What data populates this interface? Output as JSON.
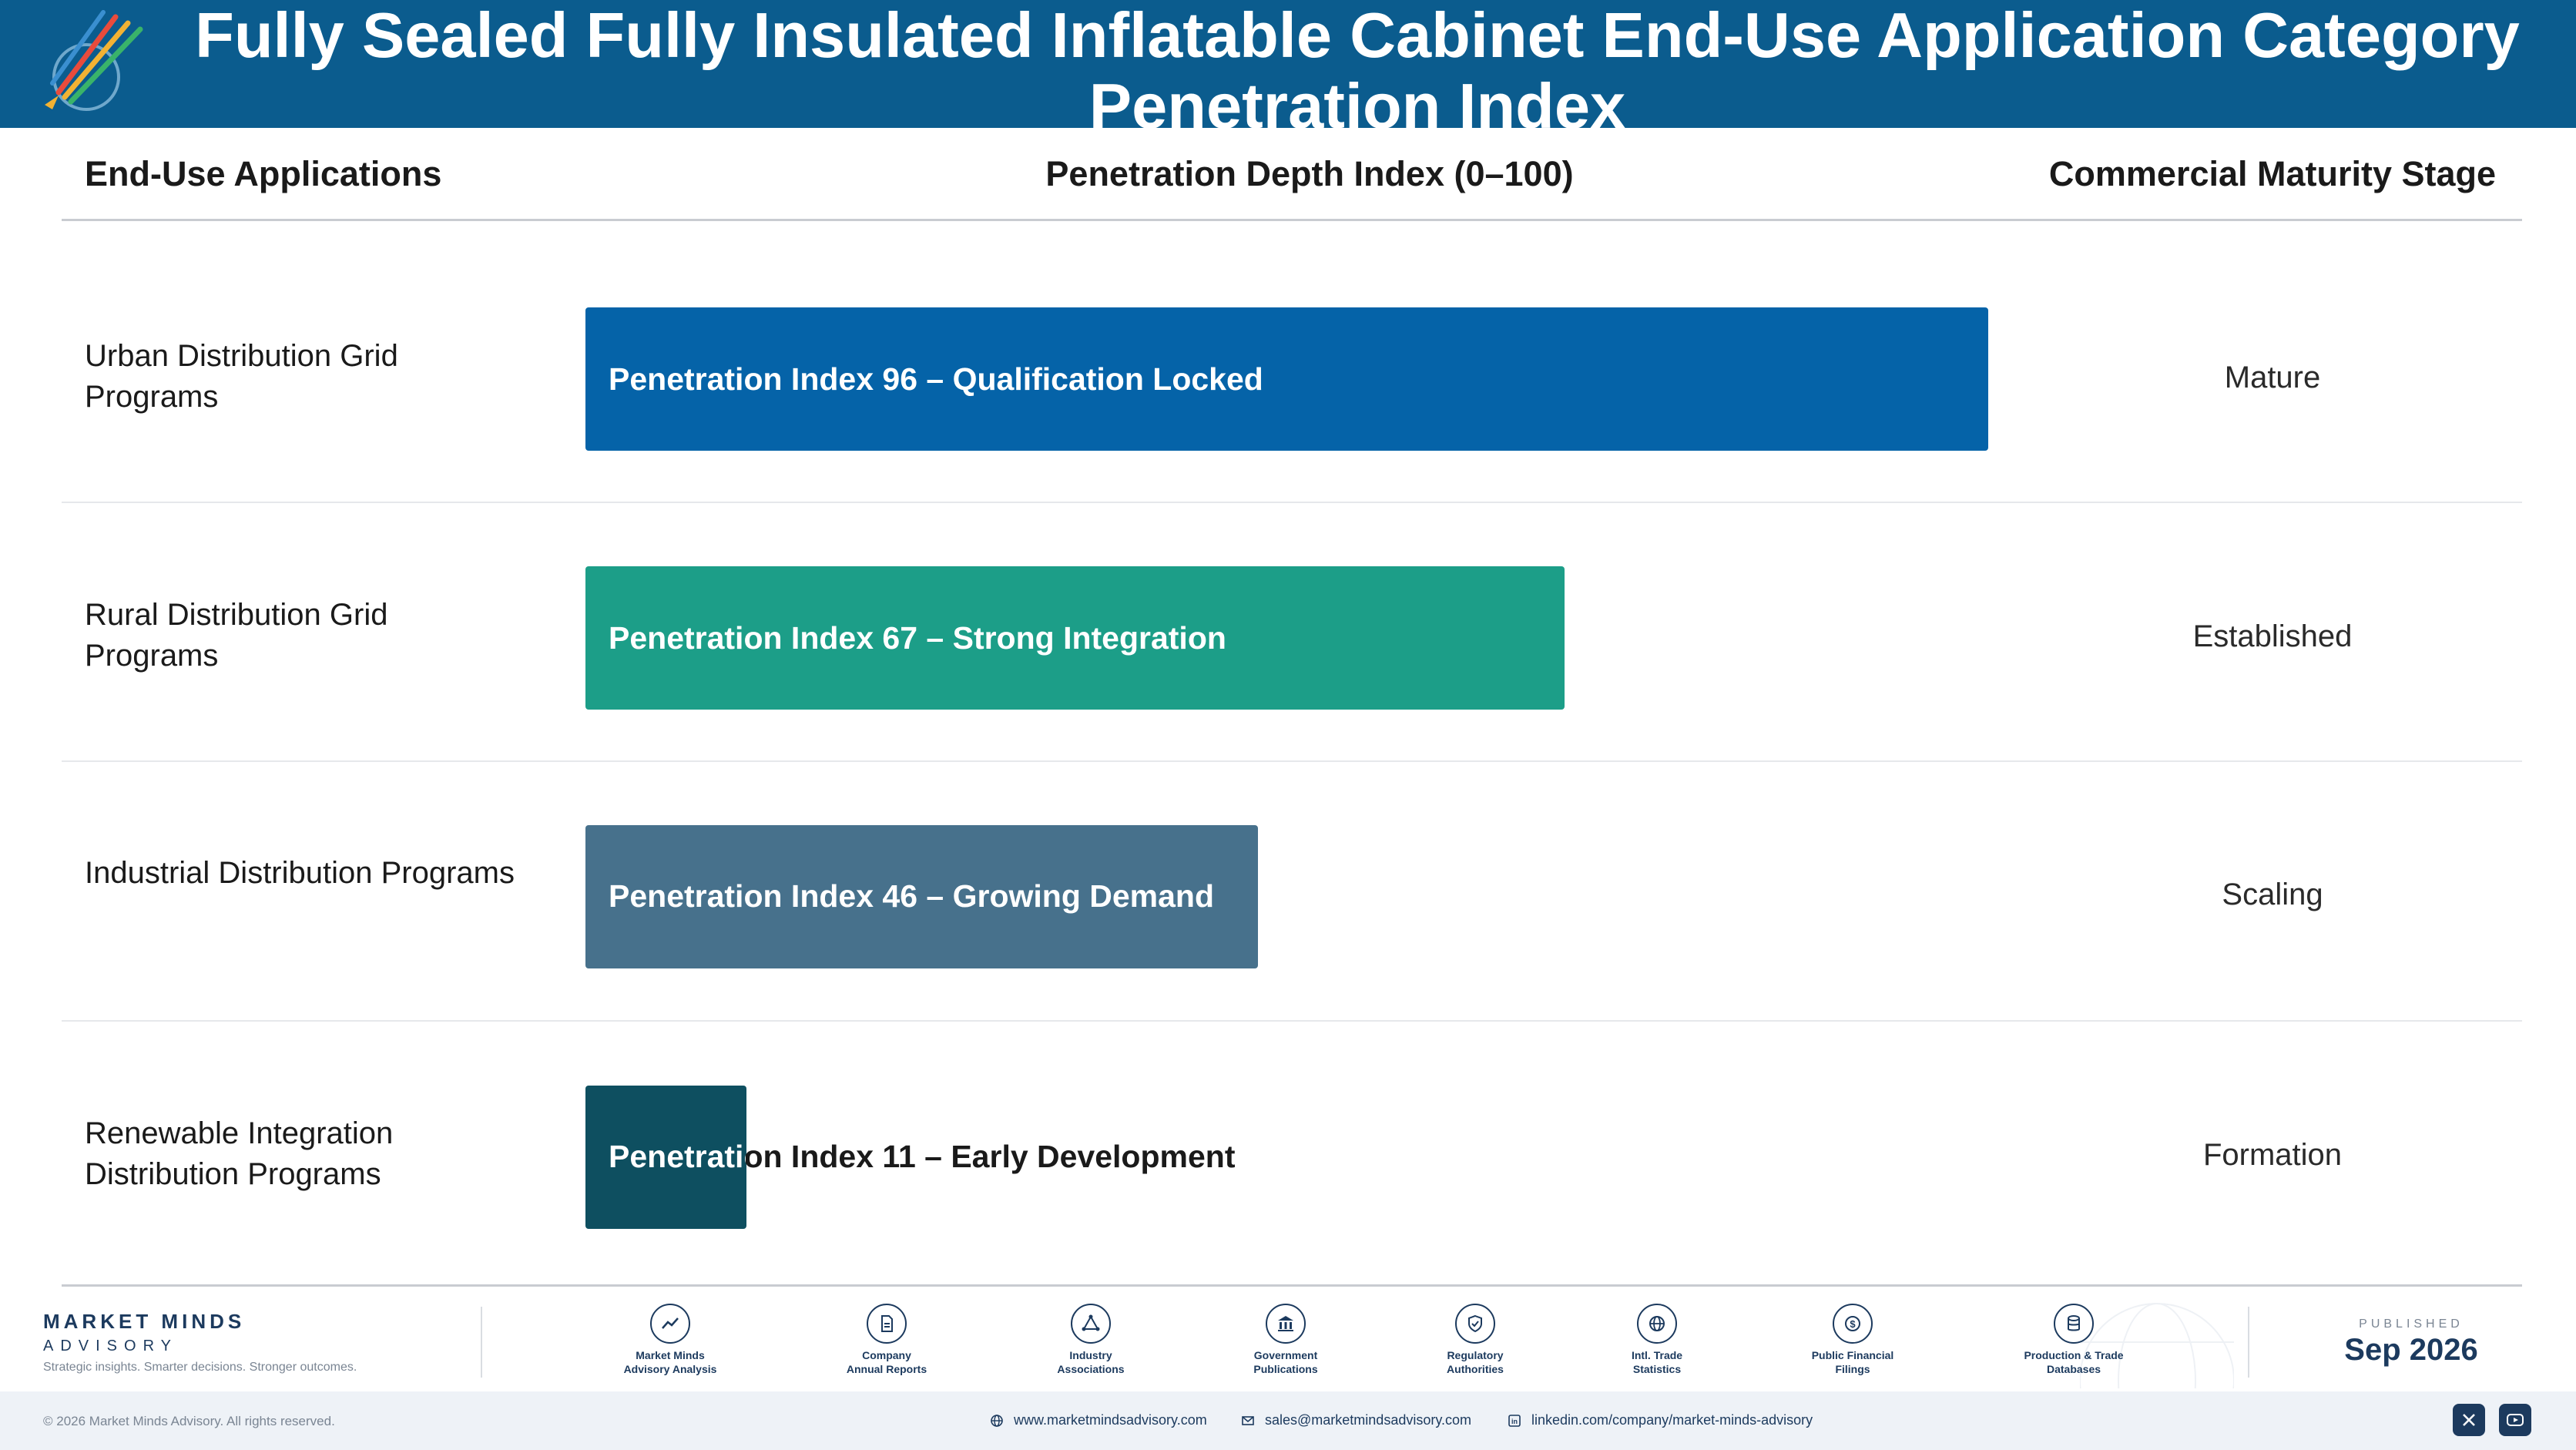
{
  "header": {
    "title": "Fully Sealed Fully Insulated Inflatable Cabinet End-Use Application Category Penetration Index",
    "logo_icon": "rising-arrows-logo-icon"
  },
  "table": {
    "columns": [
      "End-Use Applications",
      "Penetration Depth Index (0–100)",
      "Commercial Maturity Stage"
    ]
  },
  "chart_data": {
    "type": "bar",
    "orientation": "horizontal",
    "title": "Fully Sealed Fully Insulated Inflatable Cabinet End-Use Application Category Penetration Index",
    "xlabel": "Penetration Depth Index (0–100)",
    "ylabel": "End-Use Applications",
    "xlim": [
      0,
      100
    ],
    "grid": false,
    "categories": [
      "Urban Distribution Grid Programs",
      "Rural Distribution Grid Programs",
      "Industrial Distribution Programs",
      "Renewable Integration Distribution Programs"
    ],
    "values": [
      96,
      67,
      46,
      11
    ],
    "bar_labels": [
      "Penetration Index 96 – Qualification Locked",
      "Penetration Index 67 – Strong Integration",
      "Penetration Index 46 – Growing Demand",
      "Penetration Index 11 – Early Development"
    ],
    "stages": [
      "Mature",
      "Established",
      "Scaling",
      "Formation"
    ],
    "colors": [
      "#0563a8",
      "#1c9e88",
      "#47718c",
      "#0e4f60"
    ]
  },
  "footer": {
    "brand_name": "MARKET MINDS",
    "brand_sub": "ADVISORY",
    "brand_tagline": "Strategic insights. Smarter decisions. Stronger outcomes.",
    "sources": [
      {
        "label_1": "Market Minds",
        "label_2": "Advisory Analysis",
        "icon": "chart-trend-icon"
      },
      {
        "label_1": "Company",
        "label_2": "Annual Reports",
        "icon": "document-icon"
      },
      {
        "label_1": "Industry",
        "label_2": "Associations",
        "icon": "network-icon"
      },
      {
        "label_1": "Government",
        "label_2": "Publications",
        "icon": "government-building-icon"
      },
      {
        "label_1": "Regulatory",
        "label_2": "Authorities",
        "icon": "shield-icon"
      },
      {
        "label_1": "Intl. Trade",
        "label_2": "Statistics",
        "icon": "globe-icon"
      },
      {
        "label_1": "Public Financial",
        "label_2": "Filings",
        "icon": "dollar-coin-icon"
      },
      {
        "label_1": "Production & Trade",
        "label_2": "Databases",
        "icon": "database-icon"
      }
    ],
    "published_label": "PUBLISHED",
    "published_date": "Sep 2026",
    "copyright": "© 2026 Market Minds Advisory. All rights reserved.",
    "website": "www.marketmindsadvisory.com",
    "email": "sales@marketmindsadvisory.com",
    "linkedin": "linkedin.com/company/market-minds-advisory"
  }
}
